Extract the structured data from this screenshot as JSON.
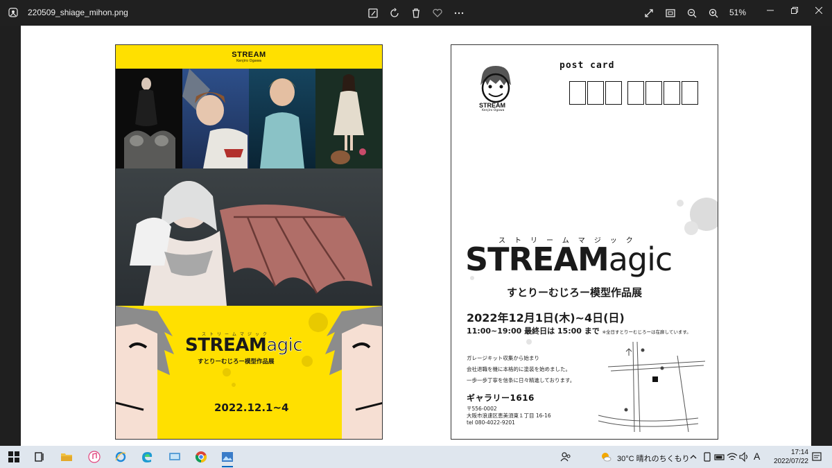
{
  "window": {
    "filename": "220509_shiage_mihon.png",
    "zoom": "51%"
  },
  "toolbar": {
    "icons": [
      "edit-image-icon",
      "rotate-icon",
      "delete-icon",
      "favorite-icon",
      "more-icon"
    ],
    "right_icons": [
      "fullscreen-icon",
      "fit-icon",
      "zoom-out-icon",
      "zoom-in-icon"
    ]
  },
  "flyer": {
    "brand": "STREAM",
    "artist": "Kenjiro Ogawa",
    "kana": "ストリームマジック",
    "title_main": "STREAM",
    "title_tail": "agic",
    "subtitle": "すとりーむじろー模型作品展",
    "date": "2022.12.1~4",
    "accent_color": "#ffe000"
  },
  "postcard": {
    "post_label": "post card",
    "logo_brand": "STREAM",
    "logo_artist": "Kenjiro Ogawa",
    "kana": "ストリームマジック",
    "title_main": "STREAM",
    "title_tail": "agic",
    "subtitle": "すとりーむじろー模型作品展",
    "date": "2022年12月1日(木)~4日(日)",
    "time": "11:00~19:00 最終日は 15:00 まで",
    "time_note": "※全日すとりーむじろーは在廊しています。",
    "desc_lines": [
      "ガレージキット収集から始まり",
      "会社退職を機に本格的に塗装を始めました。",
      "一歩一歩丁寧を信条に日々精進しております。"
    ],
    "gallery": "ギャラリー1616",
    "addr_lines": [
      "〒556-0002",
      "大阪市浪速区恵美須東１丁目 16-16",
      "tel 080-4022-9201"
    ]
  },
  "taskbar": {
    "weather": "30°C  晴れのちくもり",
    "ime": "A",
    "time": "17:14",
    "date": "2022/07/22"
  }
}
